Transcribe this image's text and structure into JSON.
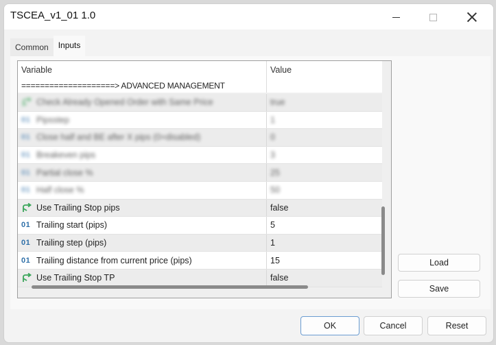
{
  "window": {
    "title": "TSCEA_v1_01 1.0",
    "controls": {
      "minimize": "minimize",
      "maximize": "maximize",
      "close": "close"
    }
  },
  "tabs": [
    {
      "label": "Common",
      "active": false
    },
    {
      "label": "Inputs",
      "active": true
    }
  ],
  "grid": {
    "columns": {
      "variable": "Variable",
      "value": "Value"
    },
    "section_label": "====================> ADVANCED MANAGEMENT",
    "rows": [
      {
        "icon": "bool-icon",
        "name": "Check Already Opened Order with Same Price",
        "value": "true",
        "blurred": true
      },
      {
        "icon": "int-icon",
        "name": "Pipsstep",
        "value": "1",
        "blurred": true
      },
      {
        "icon": "int-icon",
        "name": "Close half and BE after X pips (0=disabled)",
        "value": "0",
        "blurred": true
      },
      {
        "icon": "int-icon",
        "name": "Breakeven pips",
        "value": "3",
        "blurred": true
      },
      {
        "icon": "int-icon",
        "name": "Partial close %",
        "value": "25",
        "blurred": true
      },
      {
        "icon": "int-icon",
        "name": "Half close %",
        "value": "50",
        "blurred": true
      },
      {
        "icon": "bool-icon",
        "name": "Use Trailing Stop pips",
        "value": "false",
        "blurred": false
      },
      {
        "icon": "int-icon",
        "name": "Trailing start (pips)",
        "value": "5",
        "blurred": false
      },
      {
        "icon": "int-icon",
        "name": " Trailing step (pips)",
        "value": "1",
        "blurred": false
      },
      {
        "icon": "int-icon",
        "name": "Trailing distance from current price (pips)",
        "value": "15",
        "blurred": false
      },
      {
        "icon": "bool-icon",
        "name": "Use Trailing Stop TP",
        "value": "false",
        "blurred": false
      }
    ],
    "int_icon_text": "01"
  },
  "side_buttons": {
    "load": "Load",
    "save": "Save"
  },
  "footer": {
    "ok": "OK",
    "cancel": "Cancel",
    "reset": "Reset"
  },
  "colors": {
    "bool_icon": "#3aa65a",
    "int_icon": "#2e6fa8",
    "ok_border": "#6a9bd1"
  }
}
